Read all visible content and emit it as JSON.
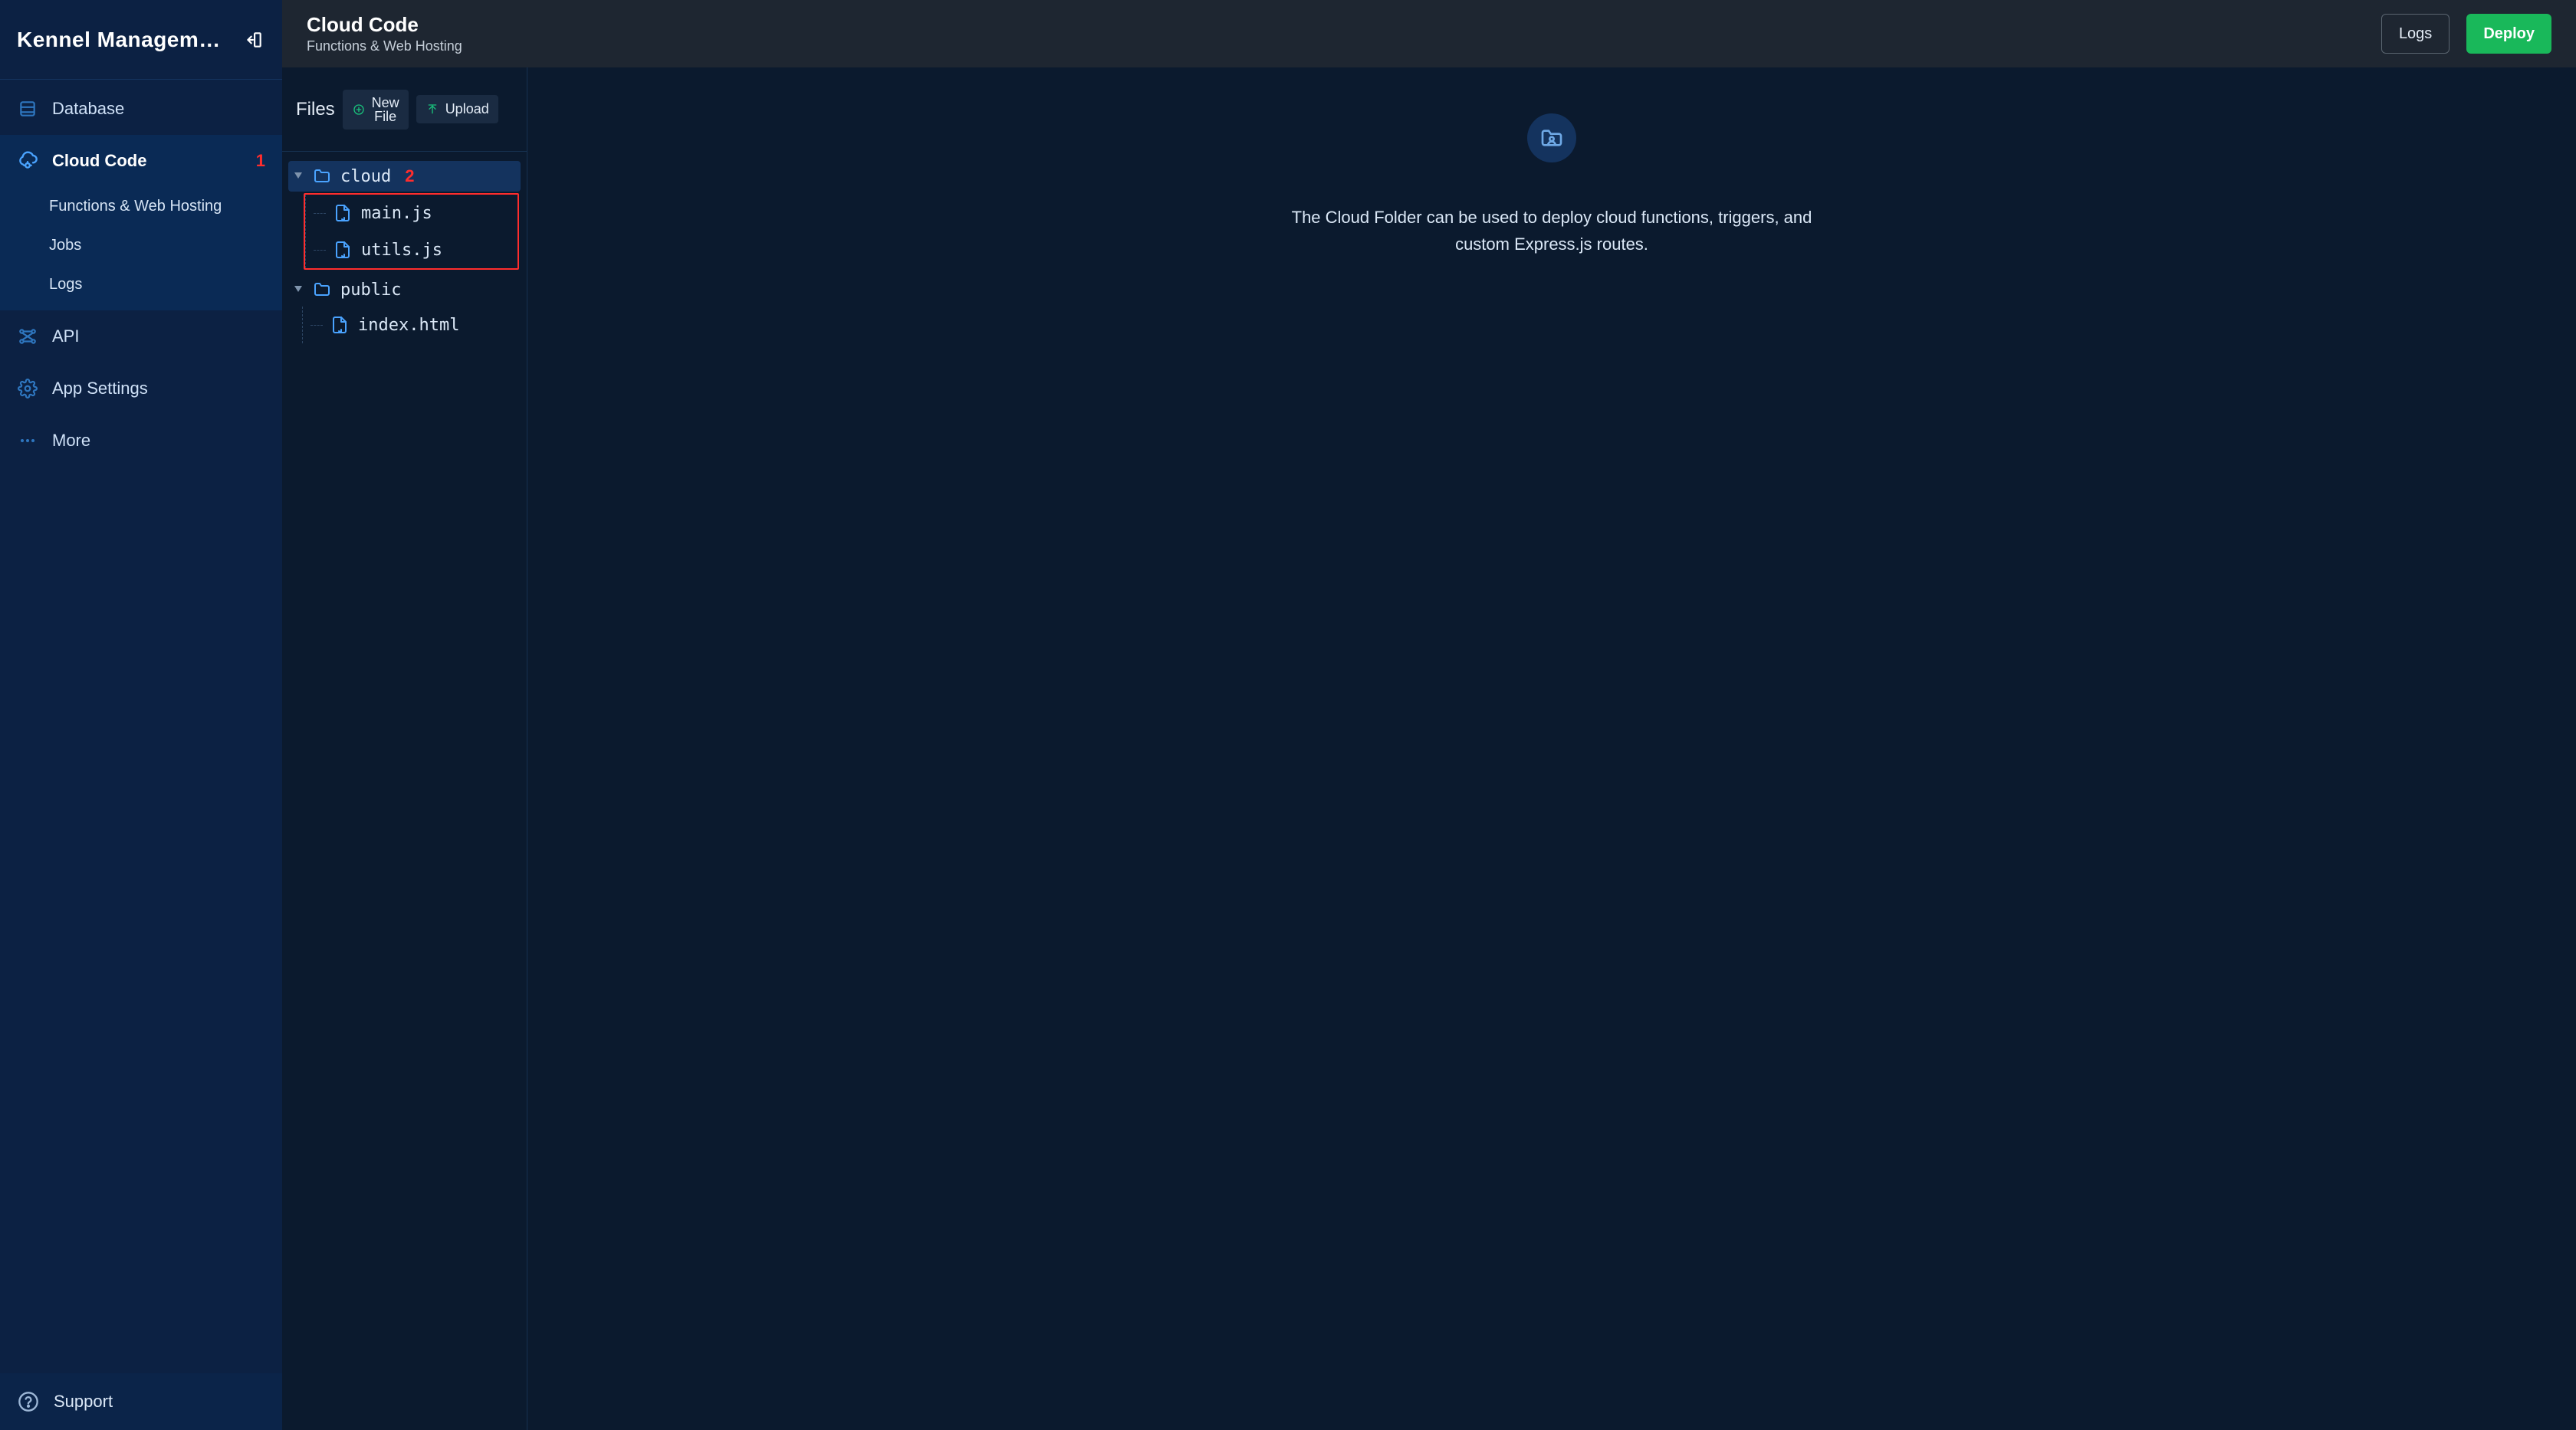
{
  "app": {
    "title": "Kennel Management ..."
  },
  "sidebar": {
    "items": [
      {
        "key": "database",
        "label": "Database"
      },
      {
        "key": "cloud-code",
        "label": "Cloud Code",
        "badge": "1"
      },
      {
        "key": "api",
        "label": "API"
      },
      {
        "key": "app-settings",
        "label": "App Settings"
      },
      {
        "key": "more",
        "label": "More"
      }
    ],
    "cloud_sub": [
      {
        "key": "functions",
        "label": "Functions & Web Hosting"
      },
      {
        "key": "jobs",
        "label": "Jobs"
      },
      {
        "key": "logs",
        "label": "Logs"
      }
    ],
    "support": "Support"
  },
  "topbar": {
    "title": "Cloud Code",
    "subtitle": "Functions & Web Hosting",
    "logs": "Logs",
    "deploy": "Deploy"
  },
  "files": {
    "label": "Files",
    "new_file": "New\nFile",
    "upload": "Upload",
    "tree": {
      "cloud": {
        "label": "cloud",
        "badge": "2"
      },
      "cloud_children": [
        {
          "label": "main.js"
        },
        {
          "label": "utils.js"
        }
      ],
      "public": {
        "label": "public"
      },
      "public_children": [
        {
          "label": "index.html"
        }
      ]
    }
  },
  "detail": {
    "text": "The Cloud Folder can be used to deploy cloud functions, triggers, and custom Express.js routes."
  }
}
